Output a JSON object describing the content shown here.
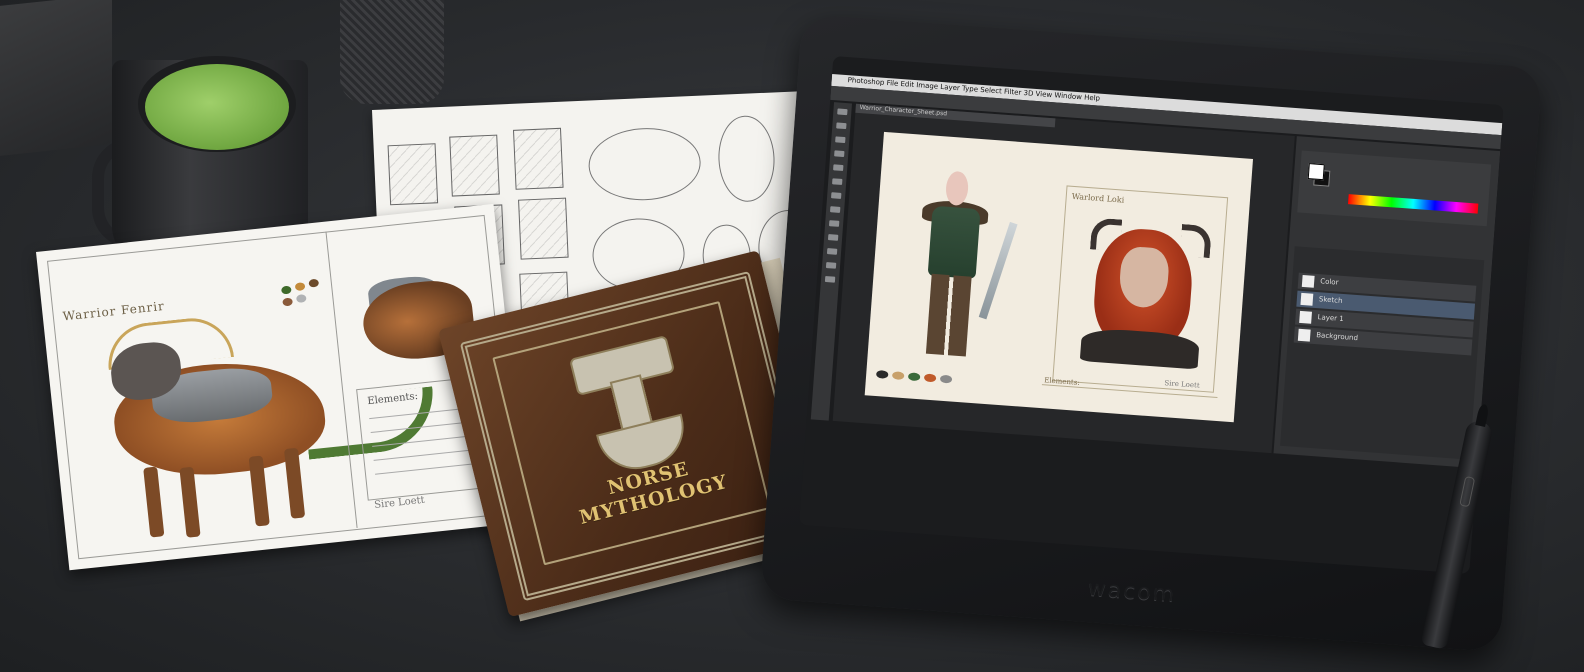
{
  "sketch_sheet": {
    "thumbnails": 12
  },
  "wolf_sheet": {
    "title": "Warrior Fenrir",
    "notes_title": "Elements:",
    "signature": "Sire Loett",
    "swatch_colors": [
      "#3e6a2a",
      "#c38a3a",
      "#6c4a2a",
      "#8a5a3a",
      "#b0b2b4"
    ]
  },
  "book": {
    "title_line1": "NORSE",
    "title_line2": "MYTHOLOGY"
  },
  "tablet": {
    "brand": "wacom",
    "photoshop": {
      "menu": "Photoshop  File  Edit  Image  Layer  Type  Select  Filter  3D  View  Window  Help",
      "doc_tab": "Warrior_Character_Sheet.psd",
      "portrait_title": "Warlord Loki",
      "notes_title": "Elements:",
      "signature": "Sire Loett",
      "layers": [
        "Color",
        "Sketch",
        "Layer 1",
        "Background"
      ],
      "doc_swatches": [
        "#2a2a2a",
        "#c8a06a",
        "#3a6a3a",
        "#c05a2a",
        "#8a8a8a"
      ]
    }
  },
  "scene": {
    "latte_color": "#8cc25a",
    "desk_color": "#2c2e31"
  }
}
